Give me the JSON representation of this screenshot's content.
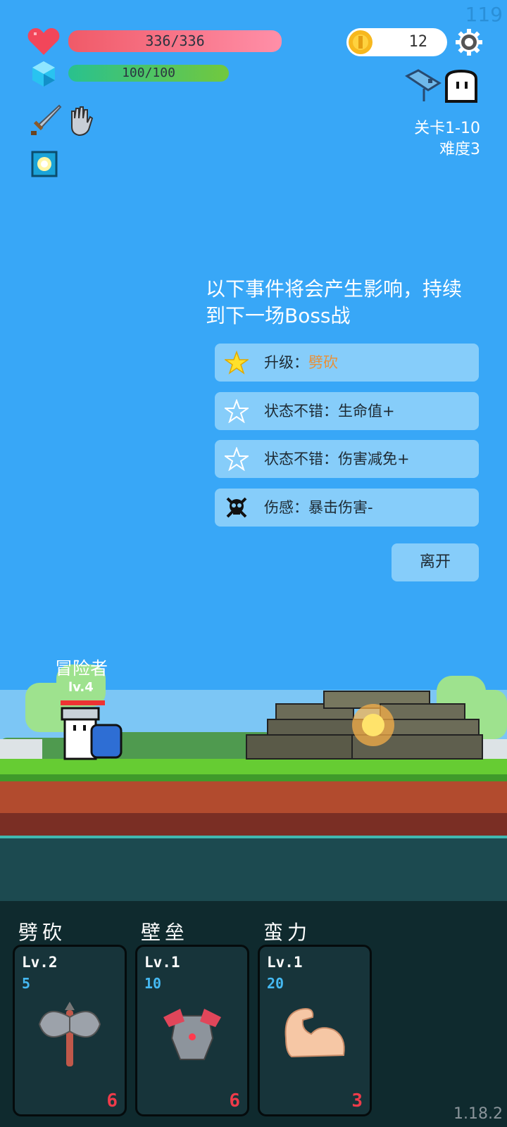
{
  "hud": {
    "fps": "119",
    "hp_text": "336/336",
    "hp_fraction": 1.0,
    "mp_text": "100/100",
    "mp_fraction": 1.0,
    "coins": "12",
    "stage": "关卡1-10",
    "difficulty": "难度3"
  },
  "event_panel": {
    "title": "以下事件将会产生影响，持续到下一场Boss战",
    "items": [
      {
        "icon": "star-filled-icon",
        "label": "升级：",
        "highlight": "劈砍"
      },
      {
        "icon": "star-outline-icon",
        "label": "状态不错：生命值+",
        "highlight": ""
      },
      {
        "icon": "star-outline-icon",
        "label": "状态不错：伤害减免+",
        "highlight": ""
      },
      {
        "icon": "skull-icon",
        "label": "伤感：暴击伤害-",
        "highlight": ""
      }
    ],
    "leave_label": "离开"
  },
  "hero": {
    "name": "冒险者",
    "level": "lv.4"
  },
  "skills": [
    {
      "name": "劈砍",
      "level": "Lv.2",
      "cost": "5",
      "count": "6",
      "icon": "axe-icon"
    },
    {
      "name": "壁垒",
      "level": "Lv.1",
      "cost": "10",
      "count": "6",
      "icon": "armor-icon"
    },
    {
      "name": "蛮力",
      "level": "Lv.1",
      "cost": "20",
      "count": "3",
      "icon": "muscle-arm-icon"
    }
  ],
  "version": "1.18.2",
  "colors": {
    "sky": "#38a7f7",
    "hp": "#f05a68",
    "mp": "#29c18e",
    "event_bg": "#86cdfa",
    "highlight": "#e8913a",
    "card_bg": "#17343a"
  }
}
